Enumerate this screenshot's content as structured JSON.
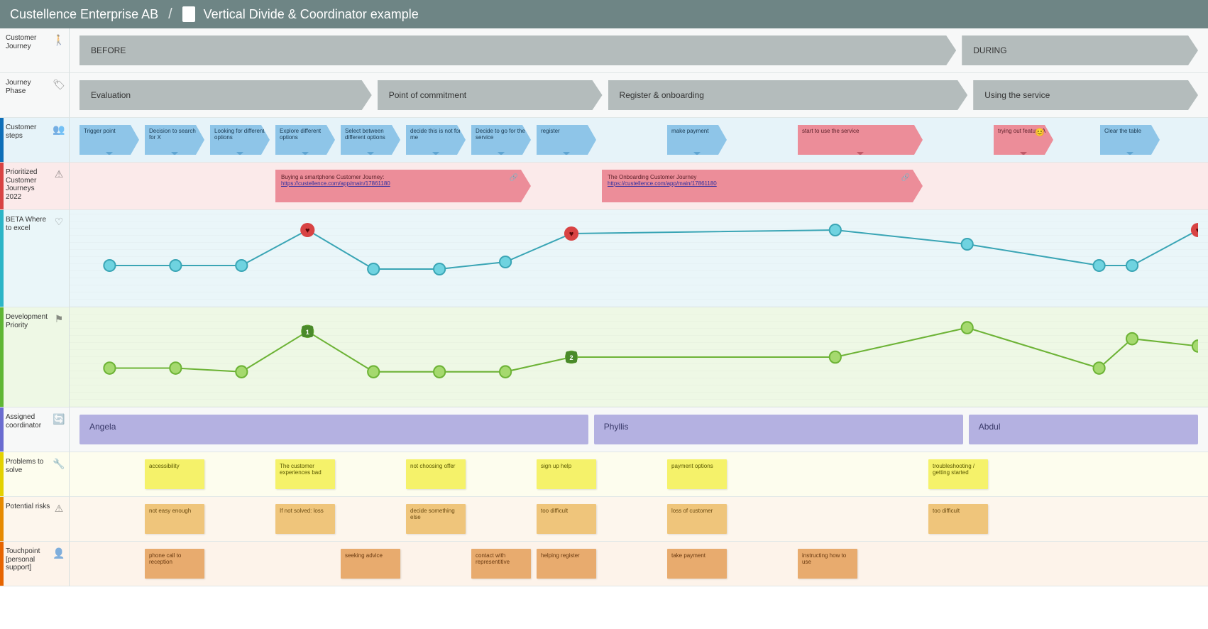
{
  "header": {
    "org": "Custellence Enterprise AB",
    "title": "Vertical Divide & Coordinator example"
  },
  "lanes": {
    "journey": "Customer Journey",
    "phase": "Journey Phase",
    "steps": "Customer steps",
    "prior": "Prioritized Customer Journeys 2022",
    "beta": "BETA Where to excel",
    "dev": "Development Priority",
    "coord": "Assigned coordinator",
    "prob": "Problems to solve",
    "risk": "Potential risks",
    "touch": "Touchpoint [personal support]"
  },
  "journey_stages": [
    {
      "label": "BEFORE",
      "flex": 12
    },
    {
      "label": "DURING",
      "flex": 3
    }
  ],
  "phases": [
    {
      "label": "Evaluation",
      "flex": 4
    },
    {
      "label": "Point of commitment",
      "flex": 3
    },
    {
      "label": "Register & onboarding",
      "flex": 5
    },
    {
      "label": "Using the service",
      "flex": 3
    }
  ],
  "steps": [
    {
      "label": "Trigger point",
      "color": "blue"
    },
    {
      "label": "Decision to search for X",
      "color": "blue"
    },
    {
      "label": "Looking for different options",
      "color": "blue"
    },
    {
      "label": "Explore different options",
      "color": "blue"
    },
    {
      "label": "Select between different options",
      "color": "blue"
    },
    {
      "label": "decide this is not for me",
      "color": "blue"
    },
    {
      "label": "Decide to go for the service",
      "color": "blue"
    },
    {
      "label": "register",
      "color": "blue"
    },
    {
      "label": null
    },
    {
      "label": "make payment",
      "color": "blue"
    },
    {
      "label": null
    },
    {
      "label": "start to use the service",
      "color": "pink",
      "wide": true
    },
    {
      "label": null
    },
    {
      "label": "trying out feature A",
      "color": "pink",
      "emoji": "😊"
    },
    {
      "label": null,
      "mini": true
    },
    {
      "label": "Clear the table",
      "color": "blue"
    }
  ],
  "prioritized": [
    {
      "offset": 3,
      "span": 4,
      "title": "Buying a smartphone Customer Journey:",
      "url": "https://custellence.com/app/main/17861180"
    },
    {
      "offset": 1,
      "span": 5,
      "title": "The Onboarding Customer Journey",
      "url": "https://custellence.com/app/main/17861180"
    }
  ],
  "chart_data": [
    {
      "type": "line",
      "name": "BETA Where to excel",
      "categories": [
        "Trigger point",
        "Decision to search for X",
        "Looking for different options",
        "Explore different options",
        "Select between different options",
        "decide this is not for me",
        "Decide to go for the service",
        "register",
        "make payment",
        "start to use the service",
        "trying out feature A",
        "(blank)",
        "Clear the table"
      ],
      "values": [
        40,
        40,
        40,
        90,
        35,
        35,
        45,
        85,
        90,
        70,
        40,
        40,
        90
      ],
      "hearts": [
        3,
        7,
        12
      ],
      "ylim": [
        0,
        100
      ]
    },
    {
      "type": "line",
      "name": "Development Priority",
      "categories": [
        "Trigger point",
        "Decision to search for X",
        "Looking for different options",
        "Explore different options",
        "Select between different options",
        "decide this is not for me",
        "Decide to go for the service",
        "register",
        "make payment",
        "start to use the service",
        "trying out feature A",
        "(blank)",
        "Clear the table"
      ],
      "values": [
        35,
        35,
        30,
        85,
        30,
        30,
        30,
        50,
        50,
        90,
        35,
        75,
        65
      ],
      "badges": [
        {
          "index": 3,
          "label": "1"
        },
        {
          "index": 7,
          "label": "2"
        }
      ],
      "ylim": [
        0,
        100
      ]
    }
  ],
  "coordinators": [
    {
      "name": "Angela",
      "flex": 7
    },
    {
      "name": "Phyllis",
      "flex": 5
    },
    {
      "name": "Abdul",
      "flex": 3
    }
  ],
  "problems": [
    null,
    "accessibility",
    null,
    "The customer experiences bad",
    null,
    "not choosing offer",
    null,
    "sign up help",
    null,
    "payment options",
    null,
    null,
    null,
    "troubleshooting / getting started",
    null,
    null
  ],
  "risks": [
    null,
    "not easy enough",
    null,
    "If not solved: loss",
    null,
    "decide something else",
    null,
    "too difficult",
    null,
    "loss of customer",
    null,
    null,
    null,
    "too difficult",
    null,
    null
  ],
  "touchpoints": [
    null,
    "phone call to reception",
    null,
    null,
    "seeking advice",
    null,
    "contact with representitive",
    "helping register",
    null,
    "take payment",
    null,
    "instructing how to use",
    null,
    null,
    null,
    null
  ]
}
